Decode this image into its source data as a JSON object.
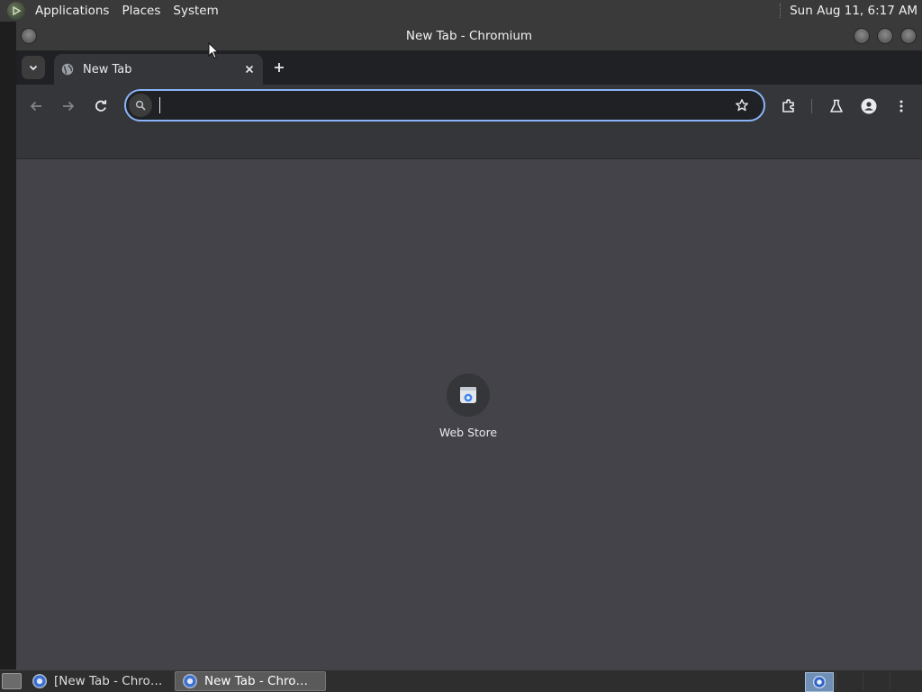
{
  "top_panel": {
    "menus": [
      "Applications",
      "Places",
      "System"
    ],
    "clock": "Sun Aug 11,  6:17 AM"
  },
  "window": {
    "title": "New Tab - Chromium"
  },
  "tabs": [
    {
      "title": "New Tab",
      "icon": "globe-icon",
      "active": true
    }
  ],
  "toolbar": {
    "omnibox_value": "",
    "icons": [
      "back-icon",
      "forward-icon",
      "reload-icon",
      "star-icon",
      "extensions-icon",
      "labs-icon",
      "profile-icon",
      "menu-icon"
    ]
  },
  "new_tab_page": {
    "shortcuts": [
      {
        "label": "Web Store",
        "icon": "web-store-icon"
      }
    ]
  },
  "taskbar": {
    "items": [
      {
        "label": "[New Tab - Chromi...",
        "active": false
      },
      {
        "label": "New Tab - Chromium",
        "active": true
      }
    ]
  },
  "colors": {
    "accent": "#8ab4f8",
    "ntp_background": "#434349",
    "toolbar_background": "#35363a",
    "tabstrip_background": "#202124"
  }
}
